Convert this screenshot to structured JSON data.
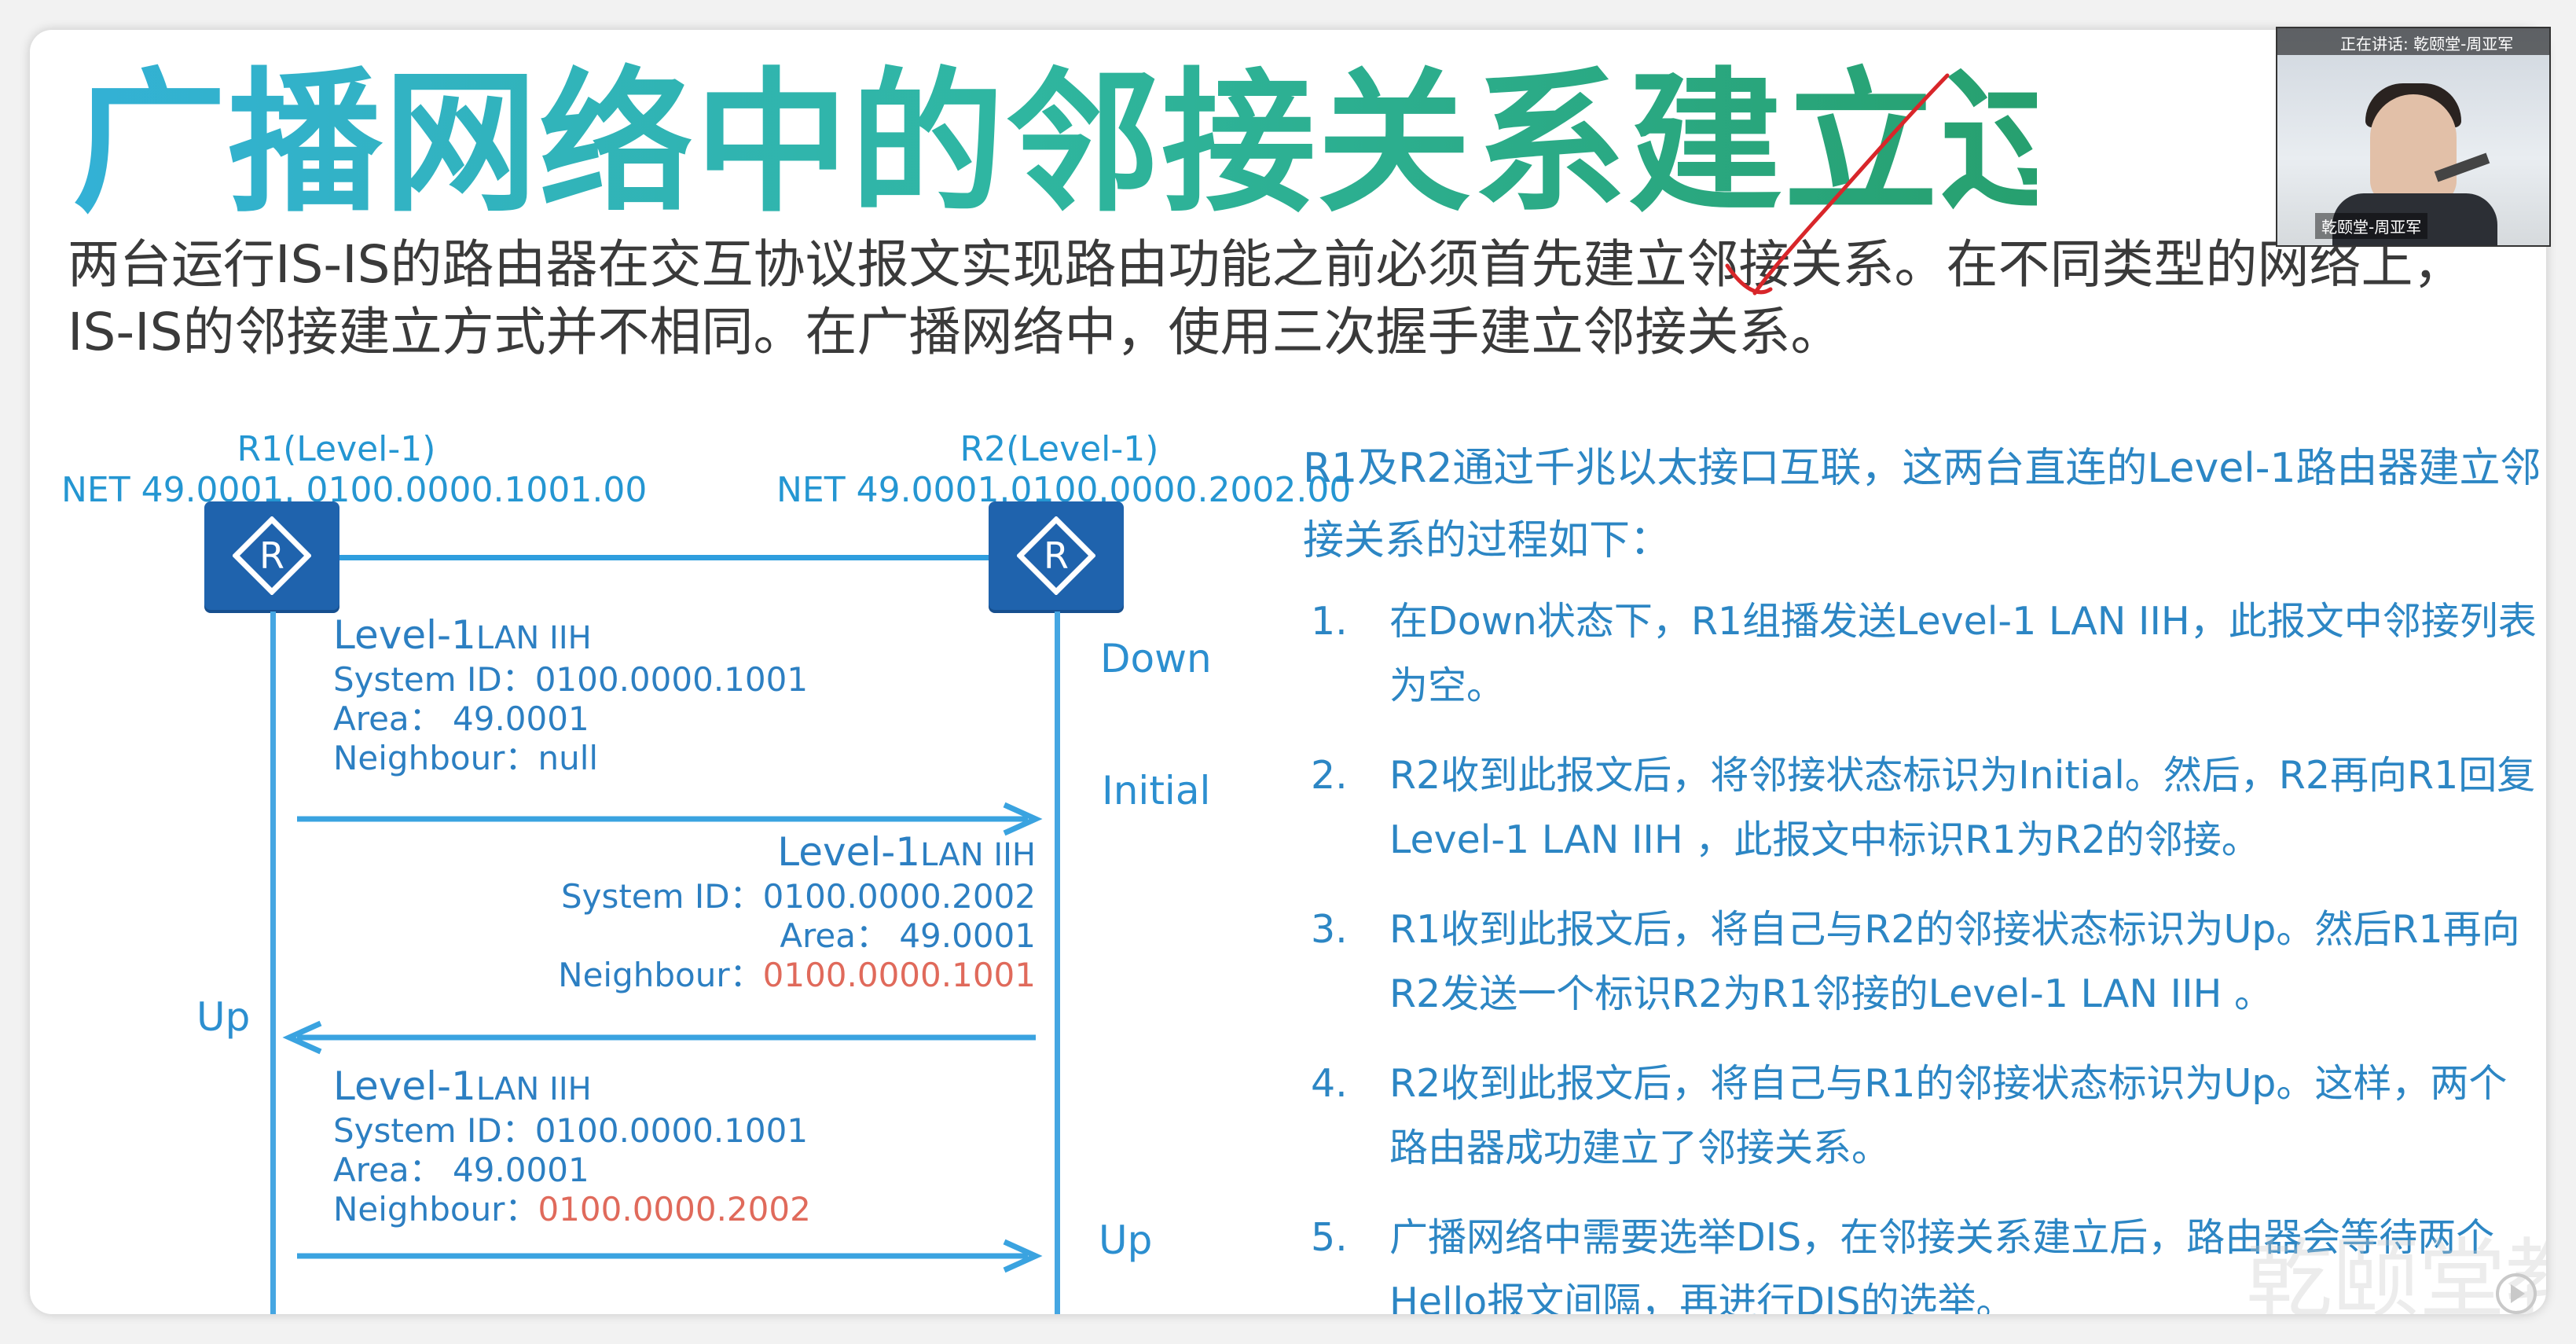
{
  "title": "广播网络中的邻接关系建立过程",
  "intro": "两台运行IS-IS的路由器在交互协议报文实现路由功能之前必须首先建立邻接关系。在不同类型的网络上，IS-IS的邻接建立方式并不相同。在广播网络中，使用三次握手建立邻接关系。",
  "diagram": {
    "r1": {
      "name": "R1(Level-1)",
      "net": "NET 49.0001. 0100.0000.1001.00",
      "icon_letter": "R"
    },
    "r2": {
      "name": "R2(Level-1)",
      "net": "NET 49.0001.0100.0000.2002.00",
      "icon_letter": "R"
    },
    "messages": [
      {
        "title_a": "Level-1",
        "title_b": "LAN IIH",
        "system_id": "System ID：0100.0000.1001",
        "area": "Area：  49.0001",
        "neighbour_label": "Neighbour：",
        "neighbour_value": "null"
      },
      {
        "title_a": "Level-1",
        "title_b": "LAN IIH",
        "system_id": "System ID：0100.0000.2002",
        "area": "Area：  49.0001",
        "neighbour_label": "Neighbour：",
        "neighbour_value": "0100.0000.1001"
      },
      {
        "title_a": "Level-1",
        "title_b": "LAN IIH",
        "system_id": "System ID：0100.0000.1001",
        "area": "Area：  49.0001",
        "neighbour_label": "Neighbour：",
        "neighbour_value": "0100.0000.2002"
      }
    ],
    "states": {
      "r2_down": "Down",
      "r2_initial": "Initial",
      "r1_up": "Up",
      "r2_up": "Up"
    }
  },
  "description": "R1及R2通过千兆以太接口互联，这两台直连的Level-1路由器建立邻接关系的过程如下：",
  "steps": [
    {
      "num": "1.",
      "text": "在Down状态下，R1组播发送Level-1  LAN  IIH，此报文中邻接列表为空。"
    },
    {
      "num": "2.",
      "text": "R2收到此报文后，将邻接状态标识为Initial。然后，R2再向R1回复Level-1 LAN IIH ，此报文中标识R1为R2的邻接。"
    },
    {
      "num": "3.",
      "text": "R1收到此报文后，将自己与R2的邻接状态标识为Up。然后R1再向R2发送一个标识R2为R1邻接的Level-1 LAN IIH 。"
    },
    {
      "num": "4.",
      "text": "R2收到此报文后，将自己与R1的邻接状态标识为Up。这样，两个路由器成功建立了邻接关系。"
    },
    {
      "num": "5.",
      "text": "广播网络中需要选举DIS，在邻接关系建立后，路由器会等待两个Hello报文间隔，再进行DIS的选举。"
    }
  ],
  "webcam": {
    "status": "正在讲话: 乾颐堂-周亚军",
    "name": "乾颐堂-周亚军"
  },
  "watermark": "乾颐堂教育",
  "colors": {
    "accent": "#2c86c4",
    "router": "#1f63ad",
    "highlight": "#e06a5b",
    "annotation": "#d8262a"
  }
}
